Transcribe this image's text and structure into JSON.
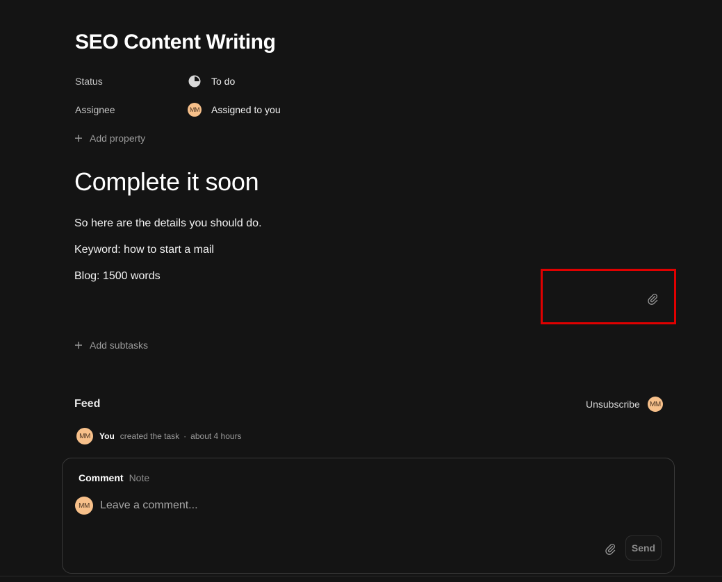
{
  "task": {
    "title": "SEO Content Writing"
  },
  "properties": {
    "status": {
      "label": "Status",
      "value": "To do",
      "icon": "pie-chart-icon"
    },
    "assignee": {
      "label": "Assignee",
      "value": "Assigned to you",
      "avatar_initials": "MM"
    },
    "add_property_label": "Add property"
  },
  "description": {
    "heading": "Complete it soon",
    "paragraphs": [
      "So here are the details you should do.",
      "Keyword: how to start a mail",
      "Blog: 1500 words"
    ],
    "attach_icon": "paperclip-icon"
  },
  "subtasks": {
    "add_label": "Add subtasks"
  },
  "feed": {
    "title": "Feed",
    "unsubscribe_label": "Unsubscribe",
    "subscriber_initials": "MM",
    "activity": {
      "avatar_initials": "MM",
      "user": "You",
      "action": "created the task",
      "separator": "·",
      "time": "about 4 hours"
    }
  },
  "composer": {
    "tabs": [
      "Comment",
      "Note"
    ],
    "active_tab": "Comment",
    "avatar_initials": "MM",
    "placeholder": "Leave a comment...",
    "send_label": "Send",
    "attach_icon": "paperclip-icon"
  },
  "colors": {
    "background": "#141414",
    "avatar": "#f7c08a",
    "highlight": "#e00000"
  }
}
